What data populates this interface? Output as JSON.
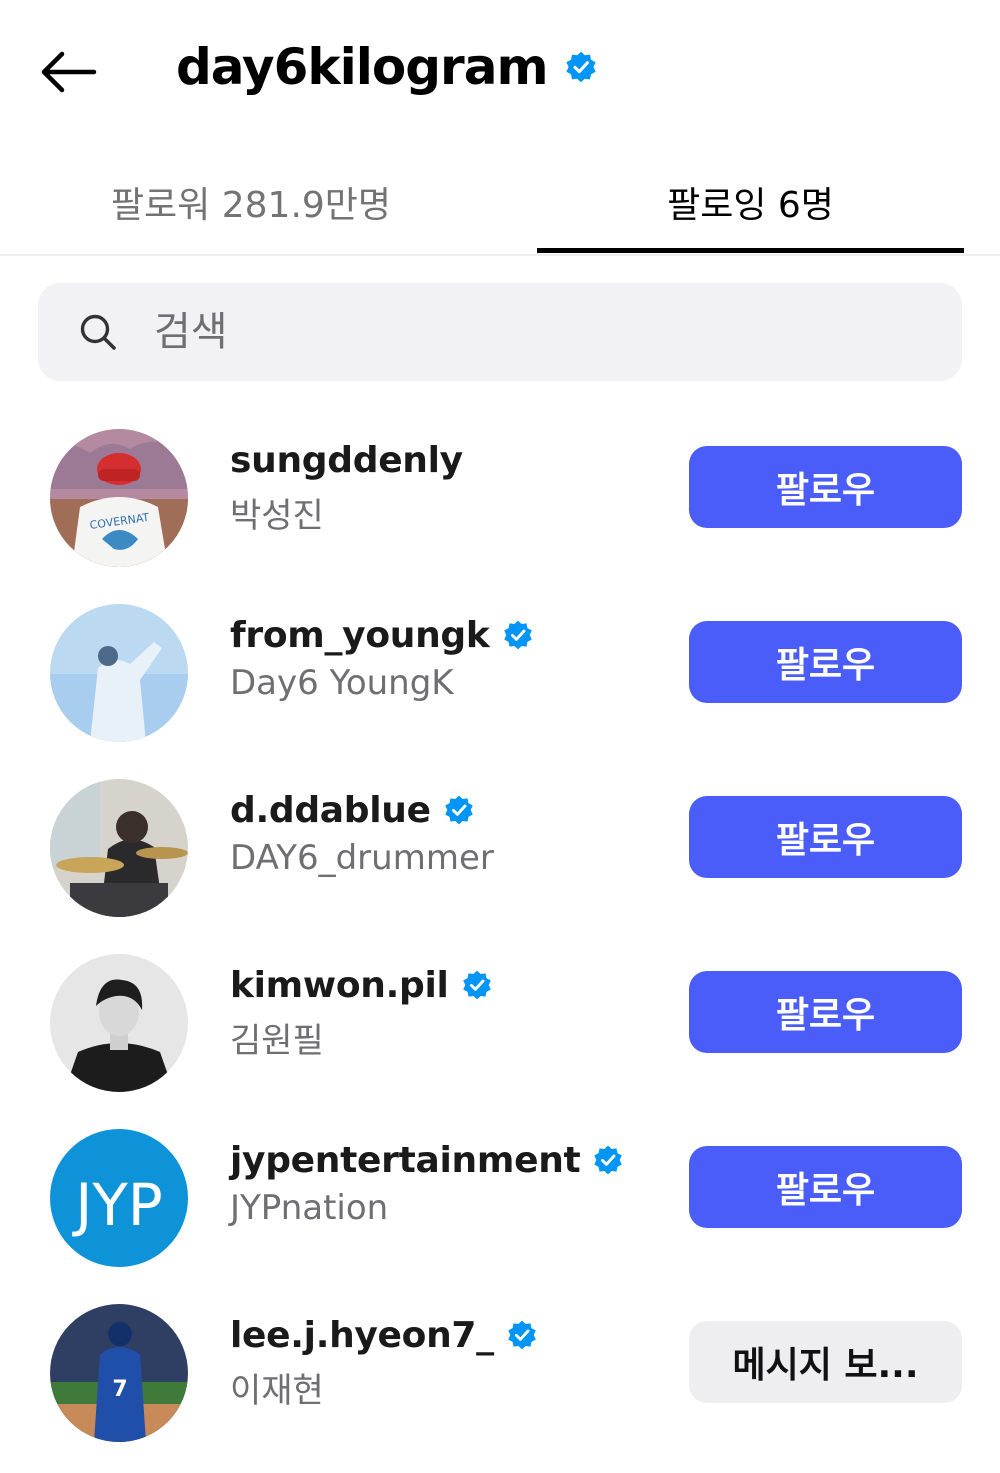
{
  "header": {
    "title": "day6kilogram",
    "verified": true,
    "back_icon": "arrow-left-icon"
  },
  "tabs": {
    "followers": "팔로워 281.9만명",
    "following": "팔로잉 6명",
    "active": "following"
  },
  "search": {
    "placeholder": "검색",
    "icon": "search-icon"
  },
  "colors": {
    "accent": "#4a5df9",
    "verified": "#0095f6",
    "secondary_text": "#6e6e73"
  },
  "following": [
    {
      "username": "sungddenly",
      "full_name": "박성진",
      "verified": false,
      "button": "팔로우"
    },
    {
      "username": "from_youngk",
      "full_name": "Day6 YoungK",
      "verified": true,
      "button": "팔로우"
    },
    {
      "username": "d.ddablue",
      "full_name": "DAY6_drummer",
      "verified": true,
      "button": "팔로우"
    },
    {
      "username": "kimwon.pil",
      "full_name": "김원필",
      "verified": true,
      "button": "팔로우"
    },
    {
      "username": "jypentertainment",
      "full_name": "JYPnation",
      "verified": true,
      "button": "팔로우"
    },
    {
      "username": "lee.j.hyeon7_",
      "full_name": "이재현",
      "verified": true,
      "button": "메시지 보..."
    }
  ],
  "avatar_texts": {
    "sungddenly_shirt": "COVERNAT",
    "jyp_logo": "JYP",
    "jersey_number": "7"
  }
}
